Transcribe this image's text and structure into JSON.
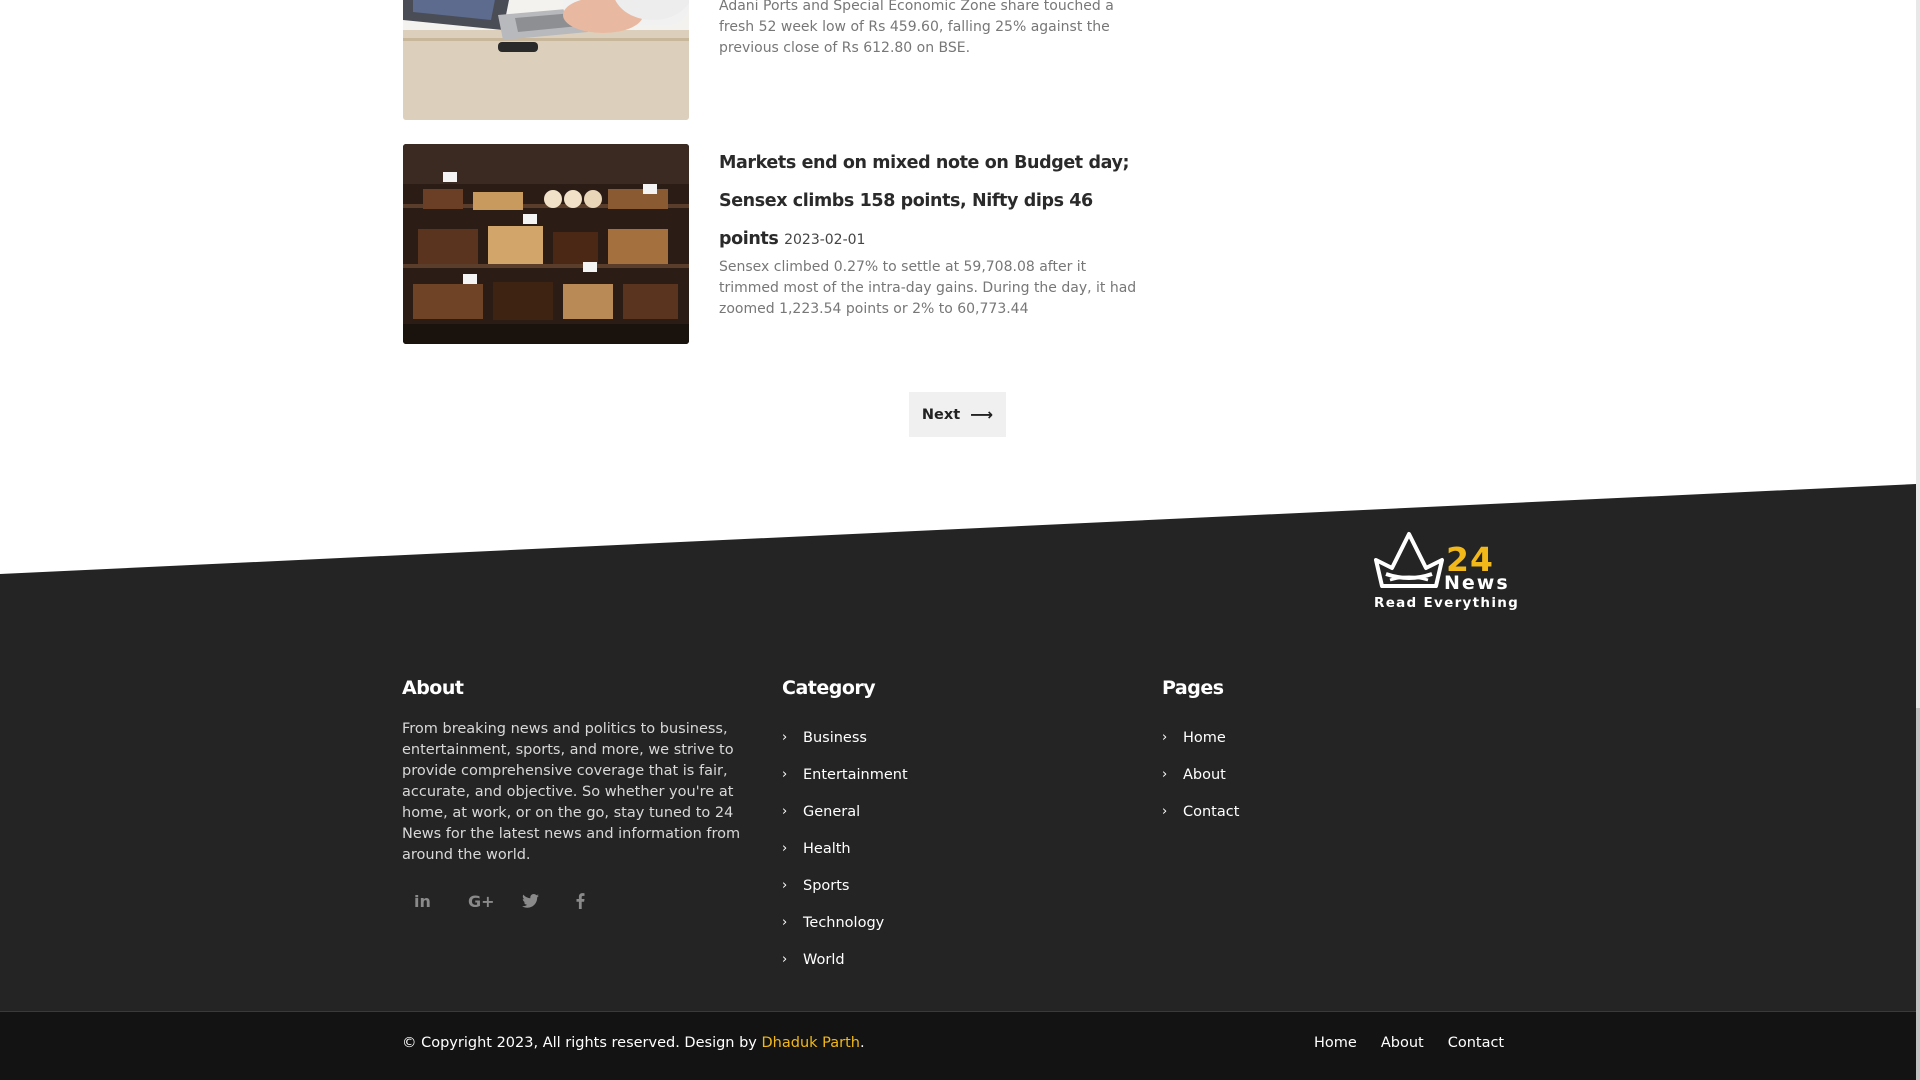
{
  "articles": [
    {
      "title": "",
      "date": "",
      "excerpt": "Adani Ports and Special Economic Zone share touched a fresh 52 week low of Rs 459.60, falling 25% against the previous close of Rs 612.80 on BSE."
    },
    {
      "title": "Markets end on mixed note on Budget day; Sensex climbs 158 points, Nifty dips 46 points",
      "date": "2023-02-01",
      "excerpt": "Sensex climbed 0.27% to settle at 59,708.08 after it trimmed most of the intra-day gains. During the day, it had zoomed 1,223.54 points or 2% to 60,773.44"
    }
  ],
  "pagination": {
    "next_label": "Next"
  },
  "logo": {
    "number": "24",
    "name": "News",
    "tagline": "Read Everything"
  },
  "footer": {
    "about": {
      "title": "About",
      "text": "From breaking news and politics to business, entertainment, sports, and more, we strive to provide comprehensive coverage that is fair, accurate, and objective. So whether you're at home, at work, or on the go, stay tuned to 24 News for the latest news and information from around the world."
    },
    "socials": [
      "linkedin-icon",
      "google-plus-icon",
      "twitter-icon",
      "facebook-icon"
    ],
    "category": {
      "title": "Category",
      "items": [
        "Business",
        "Entertainment",
        "General",
        "Health",
        "Sports",
        "Technology",
        "World"
      ]
    },
    "pages": {
      "title": "Pages",
      "items": [
        "Home",
        "About",
        "Contact"
      ]
    }
  },
  "bottom": {
    "copyright_prefix": "© Copyright 2023, All rights reserved. Design by ",
    "author": "Dhaduk Parth",
    "copyright_suffix": ".",
    "links": [
      "Home",
      "About",
      "Contact"
    ]
  },
  "colors": {
    "accent": "#f2b81a",
    "footer_bg": "#242424",
    "bottom_bg": "#131313"
  }
}
